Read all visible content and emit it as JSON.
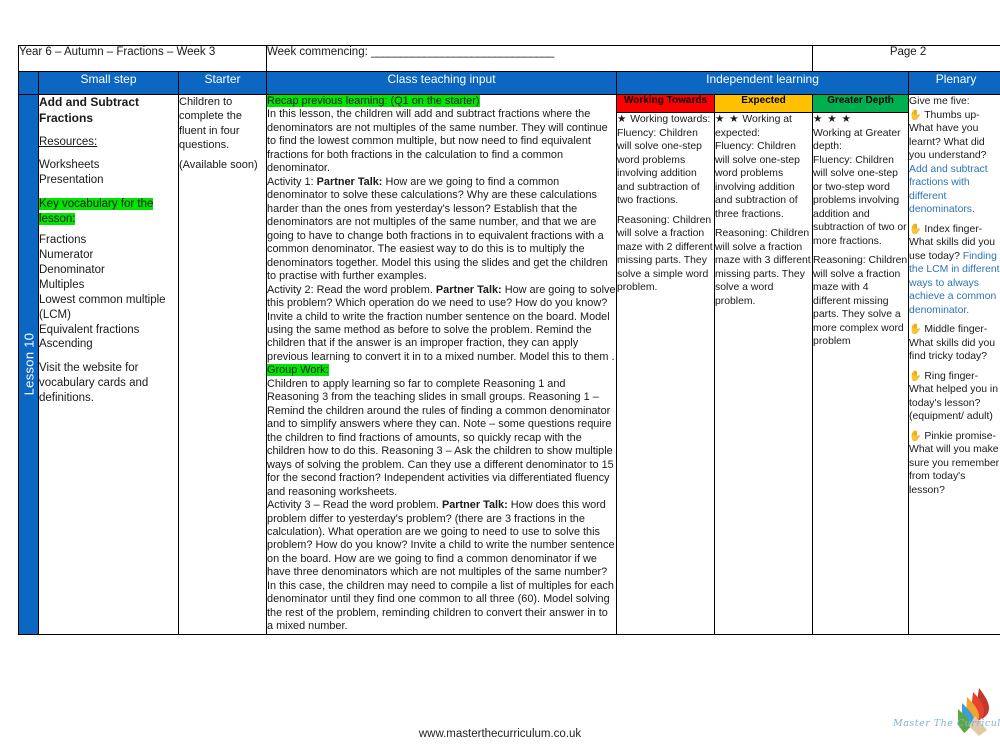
{
  "meta": {
    "title": "Year 6 – Autumn – Fractions – Week 3",
    "week_commencing_label": "Week commencing: ",
    "week_commencing_rule": "_______________________________",
    "page_number": "Page 2"
  },
  "spine": {
    "lesson_label": "Lesson 10"
  },
  "headers": {
    "small_step": "Small step",
    "starter": "Starter",
    "class_teaching_input": "Class teaching input",
    "independent_learning": "Independent learning",
    "plenary": "Plenary"
  },
  "small_step": {
    "title": "Add and Subtract Fractions",
    "resources_label": "Resources:",
    "resources": [
      "Worksheets",
      "Presentation"
    ],
    "key_vocab_heading": "Key vocabulary for the lesson:",
    "vocabulary": [
      "Fractions",
      "Numerator",
      "Denominator",
      "Multiples",
      "Lowest common multiple (LCM)",
      "Equivalent fractions",
      "Ascending"
    ],
    "website_note": "Visit the website for vocabulary cards and definitions."
  },
  "starter": {
    "text": "Children to complete the fluent in four questions.",
    "availability": "(Available soon)"
  },
  "class_teaching_input": {
    "recap_heading": "Recap previous learning: (Q1 on the starter)",
    "intro": "In this lesson, the children will add and subtract fractions where the denominators are not multiples of the same number. They will continue to find the lowest common multiple, but now need to find equivalent fractions for both fractions in the calculation to find a common denominator.",
    "activity1_label": "Activity 1:",
    "activity1_bold": "Partner Talk:",
    "activity1_text": " How are we going to find a common denominator to solve these calculations? Why are these calculations harder than the ones from yesterday's lesson? Establish that the denominators are not multiples of the same number, and that we are going to have to change both fractions in to equivalent fractions with a common denominator. The easiest way to do this is to multiply the denominators together. Model this using the slides and get the children to practise with further examples.",
    "activity2_label": "Activity 2: Read the word problem.",
    "activity2_bold": "Partner Talk:",
    "activity2_text": " How are going to solve this problem? Which operation do we need to use? How do you know? Invite a child to write the fraction number sentence on the board. Model using the same method as before to solve the problem. Remind the children that if the answer is an improper fraction, they can apply previous learning to convert it in to a mixed number. Model this to them .",
    "group_work_heading": "Group Work:",
    "group_work_text": "Children to apply learning so far to complete Reasoning 1 and Reasoning 3 from the teaching slides in small groups. Reasoning 1 – Remind the children around the rules of finding a common denominator and to simplify answers where they can. Note – some questions require the children to find fractions of amounts, so quickly recap with the children how to do this. Reasoning 3 – Ask the children to show multiple ways of solving the problem. Can they use a different denominator to 15 for the second fraction? Independent activities via differentiated fluency and reasoning worksheets.",
    "activity3_label": "Activity 3 – Read the word problem.",
    "activity3_bold": "Partner Talk:",
    "activity3_text": " How does this word problem differ to yesterday's problem? (there are 3 fractions in the calculation). What operation are we going to need to use to solve this problem? How do you  know? Invite a child to write the number sentence on the board. How are we going to find a common denominator if we have three  denominators which are not multiples of the same number? In this case, the children may need to compile a list of multiples for each denominator until they find one common to all three (60).  Model solving the rest of the problem, reminding children to convert their answer in to a mixed number."
  },
  "independent_learning": {
    "columns": [
      {
        "header": "Working Towards",
        "header_color": "#ff0000",
        "stars": "★",
        "heading": " Working towards:",
        "fluency": "Fluency: Children will solve one-step word problems involving addition and subtraction of two fractions.",
        "reasoning": "Reasoning: Children will solve a fraction maze with 2 different missing parts. They solve a simple word problem."
      },
      {
        "header": "Expected",
        "header_color": "#ffc000",
        "stars": "★ ★",
        "heading": " Working at expected:",
        "fluency": "Fluency: Children will solve one-step word problems involving addition and subtraction of three fractions.",
        "reasoning": "Reasoning: Children will solve a fraction maze with 3 different missing parts. They solve a word problem."
      },
      {
        "header": "Greater Depth",
        "header_color": "#00b050",
        "stars": "★ ★ ★",
        "heading": "Working at Greater depth:",
        "fluency": "Fluency: Children will solve one-step or two-step word problems involving addition and subtraction of two or more fractions.",
        "reasoning": "Reasoning: Children will solve a fraction maze with 4 different missing parts. They solve a more complex word problem"
      }
    ]
  },
  "plenary": {
    "intro": "Give me five:",
    "items": [
      {
        "icon": "hand-icon",
        "question": " Thumbs up- What have you learnt? What did you understand?",
        "answer": "Add and subtract fractions with different denominators."
      },
      {
        "icon": "hand-icon",
        "question": " Index finger- What skills did you use today?",
        "answer": "Finding the LCM in different ways to  always achieve a common denominator."
      },
      {
        "icon": "hand-icon",
        "question": " Middle finger- What skills did you find tricky today?",
        "answer": ""
      },
      {
        "icon": "hand-icon",
        "question": " Ring finger- What helped you in today's lesson? (equipment/ adult)",
        "answer": ""
      },
      {
        "icon": "hand-icon",
        "question": " Pinkie promise- What will you make sure you remember from today's lesson?",
        "answer": ""
      }
    ]
  },
  "footer": {
    "website": "www.masterthecurriculum.co.uk",
    "logo_script": "Master  The  Curriculum"
  }
}
